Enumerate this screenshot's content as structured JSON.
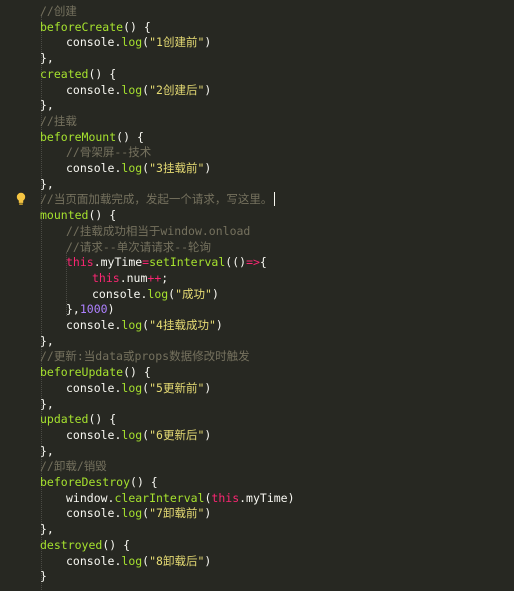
{
  "lines": [
    {
      "indent": 0,
      "tokens": [
        {
          "c": "cm",
          "t": "//创建"
        }
      ]
    },
    {
      "indent": 0,
      "tokens": [
        {
          "c": "fn",
          "t": "beforeCreate"
        },
        {
          "c": "pun",
          "t": "() {"
        }
      ]
    },
    {
      "indent": 1,
      "tokens": [
        {
          "c": "id",
          "t": "console."
        },
        {
          "c": "fn",
          "t": "log"
        },
        {
          "c": "pun",
          "t": "("
        },
        {
          "c": "str",
          "t": "\"1创建前\""
        },
        {
          "c": "pun",
          "t": ")"
        }
      ]
    },
    {
      "indent": 0,
      "tokens": [
        {
          "c": "pun",
          "t": "},"
        }
      ]
    },
    {
      "indent": 0,
      "tokens": [
        {
          "c": "fn",
          "t": "created"
        },
        {
          "c": "pun",
          "t": "() {"
        }
      ]
    },
    {
      "indent": 1,
      "tokens": [
        {
          "c": "id",
          "t": "console."
        },
        {
          "c": "fn",
          "t": "log"
        },
        {
          "c": "pun",
          "t": "("
        },
        {
          "c": "str",
          "t": "\"2创建后\""
        },
        {
          "c": "pun",
          "t": ")"
        }
      ]
    },
    {
      "indent": 0,
      "tokens": [
        {
          "c": "pun",
          "t": "},"
        }
      ]
    },
    {
      "indent": 0,
      "tokens": [
        {
          "c": "cm",
          "t": "//挂载"
        }
      ]
    },
    {
      "indent": 0,
      "tokens": [
        {
          "c": "fn",
          "t": "beforeMount"
        },
        {
          "c": "pun",
          "t": "() {"
        }
      ]
    },
    {
      "indent": 1,
      "tokens": [
        {
          "c": "cm",
          "t": "//骨架屏--技术"
        }
      ]
    },
    {
      "indent": 1,
      "tokens": [
        {
          "c": "id",
          "t": "console."
        },
        {
          "c": "fn",
          "t": "log"
        },
        {
          "c": "pun",
          "t": "("
        },
        {
          "c": "str",
          "t": "\"3挂载前\""
        },
        {
          "c": "pun",
          "t": ")"
        }
      ]
    },
    {
      "indent": 0,
      "tokens": [
        {
          "c": "pun",
          "t": "},"
        }
      ]
    },
    {
      "indent": 0,
      "tokens": [
        {
          "c": "cm",
          "t": "//当页面加载完成，发起一个请求，写这里。"
        }
      ]
    },
    {
      "indent": 0,
      "tokens": [
        {
          "c": "fn",
          "t": "mounted"
        },
        {
          "c": "pun",
          "t": "() {"
        }
      ]
    },
    {
      "indent": 1,
      "tokens": [
        {
          "c": "cm",
          "t": "//挂载成功相当于window.onload"
        }
      ]
    },
    {
      "indent": 1,
      "tokens": [
        {
          "c": "cm",
          "t": "//请求--单次请请求--轮询"
        }
      ]
    },
    {
      "indent": 1,
      "tokens": [
        {
          "c": "kw",
          "t": "this"
        },
        {
          "c": "id",
          "t": ".myTime"
        },
        {
          "c": "kw",
          "t": "="
        },
        {
          "c": "fn",
          "t": "setInterval"
        },
        {
          "c": "pun",
          "t": "(()"
        },
        {
          "c": "kw",
          "t": "=>"
        },
        {
          "c": "pun",
          "t": "{"
        }
      ]
    },
    {
      "indent": 2,
      "tokens": [
        {
          "c": "kw",
          "t": "this"
        },
        {
          "c": "id",
          "t": ".num"
        },
        {
          "c": "kw",
          "t": "++"
        },
        {
          "c": "pun",
          "t": ";"
        }
      ]
    },
    {
      "indent": 2,
      "tokens": [
        {
          "c": "id",
          "t": "console."
        },
        {
          "c": "fn",
          "t": "log"
        },
        {
          "c": "pun",
          "t": "("
        },
        {
          "c": "str",
          "t": "\"成功\""
        },
        {
          "c": "pun",
          "t": ")"
        }
      ]
    },
    {
      "indent": 1,
      "tokens": [
        {
          "c": "pun",
          "t": "},"
        },
        {
          "c": "num",
          "t": "1000"
        },
        {
          "c": "pun",
          "t": ")"
        }
      ]
    },
    {
      "indent": 1,
      "tokens": [
        {
          "c": "id",
          "t": "console."
        },
        {
          "c": "fn",
          "t": "log"
        },
        {
          "c": "pun",
          "t": "("
        },
        {
          "c": "str",
          "t": "\"4挂载成功\""
        },
        {
          "c": "pun",
          "t": ")"
        }
      ]
    },
    {
      "indent": 0,
      "tokens": [
        {
          "c": "pun",
          "t": "},"
        }
      ]
    },
    {
      "indent": 0,
      "tokens": [
        {
          "c": "cm",
          "t": "//更新:当data或props数据修改时触发"
        }
      ]
    },
    {
      "indent": 0,
      "tokens": [
        {
          "c": "fn",
          "t": "beforeUpdate"
        },
        {
          "c": "pun",
          "t": "() {"
        }
      ]
    },
    {
      "indent": 1,
      "tokens": [
        {
          "c": "id",
          "t": "console."
        },
        {
          "c": "fn",
          "t": "log"
        },
        {
          "c": "pun",
          "t": "("
        },
        {
          "c": "str",
          "t": "\"5更新前\""
        },
        {
          "c": "pun",
          "t": ")"
        }
      ]
    },
    {
      "indent": 0,
      "tokens": [
        {
          "c": "pun",
          "t": "},"
        }
      ]
    },
    {
      "indent": 0,
      "tokens": [
        {
          "c": "fn",
          "t": "updated"
        },
        {
          "c": "pun",
          "t": "() {"
        }
      ]
    },
    {
      "indent": 1,
      "tokens": [
        {
          "c": "id",
          "t": "console."
        },
        {
          "c": "fn",
          "t": "log"
        },
        {
          "c": "pun",
          "t": "("
        },
        {
          "c": "str",
          "t": "\"6更新后\""
        },
        {
          "c": "pun",
          "t": ")"
        }
      ]
    },
    {
      "indent": 0,
      "tokens": [
        {
          "c": "pun",
          "t": "},"
        }
      ]
    },
    {
      "indent": 0,
      "tokens": [
        {
          "c": "cm",
          "t": "//卸载/销毁"
        }
      ]
    },
    {
      "indent": 0,
      "tokens": [
        {
          "c": "fn",
          "t": "beforeDestroy"
        },
        {
          "c": "pun",
          "t": "() {"
        }
      ]
    },
    {
      "indent": 1,
      "tokens": [
        {
          "c": "id",
          "t": "window."
        },
        {
          "c": "fn",
          "t": "clearInterval"
        },
        {
          "c": "pun",
          "t": "("
        },
        {
          "c": "kw",
          "t": "this"
        },
        {
          "c": "id",
          "t": ".myTime"
        },
        {
          "c": "pun",
          "t": ")"
        }
      ]
    },
    {
      "indent": 1,
      "tokens": [
        {
          "c": "id",
          "t": "console."
        },
        {
          "c": "fn",
          "t": "log"
        },
        {
          "c": "pun",
          "t": "("
        },
        {
          "c": "str",
          "t": "\"7卸载前\""
        },
        {
          "c": "pun",
          "t": ")"
        }
      ]
    },
    {
      "indent": 0,
      "tokens": [
        {
          "c": "pun",
          "t": "},"
        }
      ]
    },
    {
      "indent": 0,
      "tokens": [
        {
          "c": "fn",
          "t": "destroyed"
        },
        {
          "c": "pun",
          "t": "() {"
        }
      ]
    },
    {
      "indent": 1,
      "tokens": [
        {
          "c": "id",
          "t": "console."
        },
        {
          "c": "fn",
          "t": "log"
        },
        {
          "c": "pun",
          "t": "("
        },
        {
          "c": "str",
          "t": "\"8卸载后\""
        },
        {
          "c": "pun",
          "t": ")"
        }
      ]
    },
    {
      "indent": 0,
      "tokens": [
        {
          "c": "pun",
          "t": "}"
        }
      ]
    }
  ],
  "colors": {
    "background": "#272822",
    "keyword": "#f92672",
    "function": "#a6e22e",
    "string": "#e6db74",
    "comment": "#75715e",
    "number": "#ae81ff"
  },
  "bulb_icon": "lightbulb-icon"
}
